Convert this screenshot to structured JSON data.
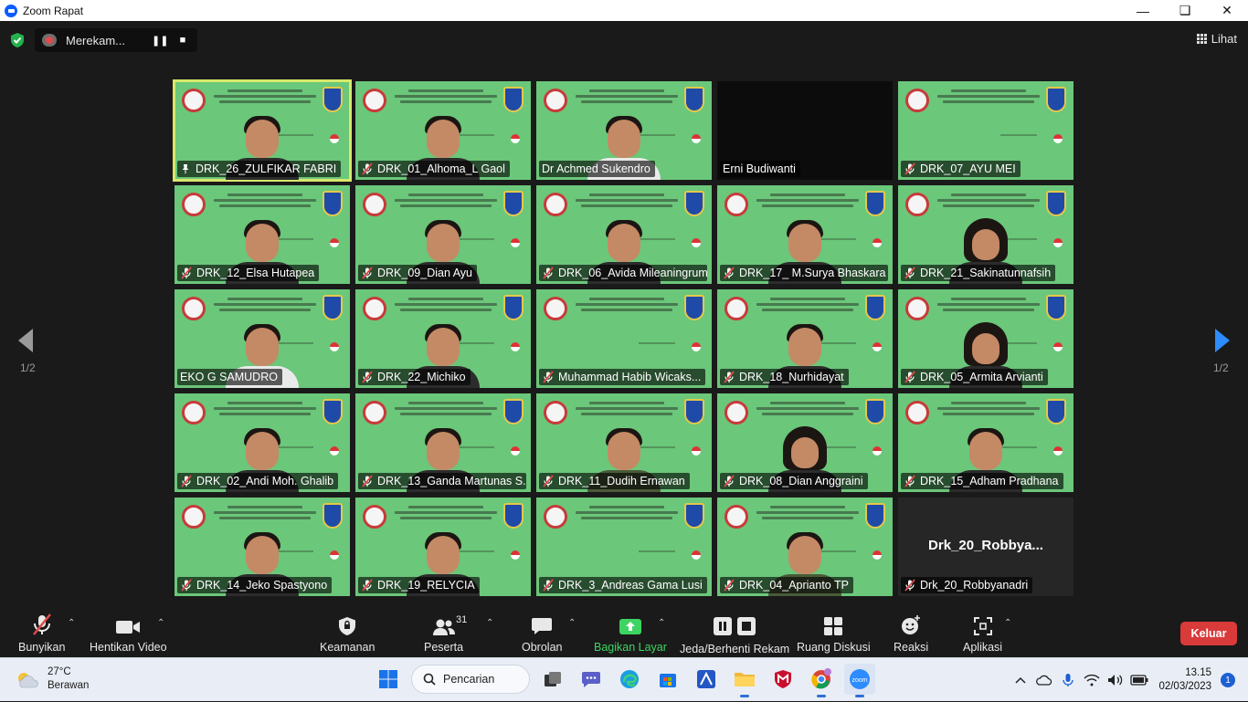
{
  "window": {
    "title": "Zoom Rapat",
    "controls": [
      "minimize",
      "maximize",
      "close"
    ]
  },
  "topbar": {
    "recording_label": "Merekam...",
    "view_label": "Lihat"
  },
  "pager": {
    "left": "1/2",
    "right": "1/2"
  },
  "participants": [
    {
      "name": "DRK_26_ZULFIKAR FABRI",
      "muted": false,
      "pinned": true,
      "active": true,
      "style": "green"
    },
    {
      "name": "DRK_01_Alhoma_L Gaol",
      "muted": true,
      "style": "green"
    },
    {
      "name": "Dr Achmed Sukendro",
      "muted": false,
      "style": "white"
    },
    {
      "name": "Erni Budiwanti",
      "muted": false,
      "style": "dark"
    },
    {
      "name": "DRK_07_AYU MEI",
      "muted": true,
      "style": "empty"
    },
    {
      "name": "DRK_12_Elsa Hutapea",
      "muted": true,
      "style": "hair"
    },
    {
      "name": "DRK_09_Dian Ayu",
      "muted": true,
      "style": "hair"
    },
    {
      "name": "DRK_06_Avida Mileaningrum",
      "muted": true,
      "style": "green"
    },
    {
      "name": "DRK_17_ M.Surya Bhaskara",
      "muted": true,
      "style": "green"
    },
    {
      "name": "DRK_21_Sakinatunnafsih",
      "muted": true,
      "style": "hijab"
    },
    {
      "name": "EKO G SAMUDRO",
      "muted": false,
      "style": "white"
    },
    {
      "name": "DRK_22_Michiko",
      "muted": true,
      "style": "green"
    },
    {
      "name": "Muhammad Habib Wicaks...",
      "muted": true,
      "style": "empty"
    },
    {
      "name": "DRK_18_Nurhidayat",
      "muted": true,
      "style": "green"
    },
    {
      "name": "DRK_05_Armita Arvianti",
      "muted": true,
      "style": "hijab"
    },
    {
      "name": "DRK_02_Andi Moh. Ghalib",
      "muted": true,
      "style": "green"
    },
    {
      "name": "DRK_13_Ganda Martunas S...",
      "muted": true,
      "style": "green"
    },
    {
      "name": "DRK_11_Dudih Ernawan",
      "muted": true,
      "style": "army"
    },
    {
      "name": "DRK_08_Dian Anggraini",
      "muted": true,
      "style": "hijab"
    },
    {
      "name": "DRK_15_Adham Pradhana",
      "muted": true,
      "style": "green"
    },
    {
      "name": "DRK_14_Jeko Spastyono",
      "muted": true,
      "style": "green"
    },
    {
      "name": "DRK_19_RELYCIA",
      "muted": true,
      "style": "hair"
    },
    {
      "name": "DRK_3_Andreas Gama Lusi",
      "muted": true,
      "style": "empty"
    },
    {
      "name": "DRK_04_Aprianto TP",
      "muted": true,
      "style": "army"
    },
    {
      "name": "Drk_20_Robbyanadri",
      "muted": true,
      "style": "noVideo",
      "display_name": "Drk_20_Robbya..."
    }
  ],
  "toolbar": {
    "mute": "Bunyikan",
    "video": "Hentikan Video",
    "security": "Keamanan",
    "participants": "Peserta",
    "participants_count": "31",
    "chat": "Obrolan",
    "share": "Bagikan Layar",
    "record": "Jeda/Berhenti Rekam",
    "breakout": "Ruang Diskusi",
    "reactions": "Reaksi",
    "apps": "Aplikasi",
    "leave": "Keluar"
  },
  "taskbar": {
    "weather_temp": "27°C",
    "weather_desc": "Berawan",
    "search": "Pencarian",
    "time": "13.15",
    "date": "02/03/2023",
    "notifications": "1"
  },
  "colors": {
    "tile_green": "#6bc77a",
    "active_outline": "#d8e86b",
    "share_green": "#3ed462",
    "leave_red": "#d93a3a",
    "mute_red": "#e04a4a"
  }
}
